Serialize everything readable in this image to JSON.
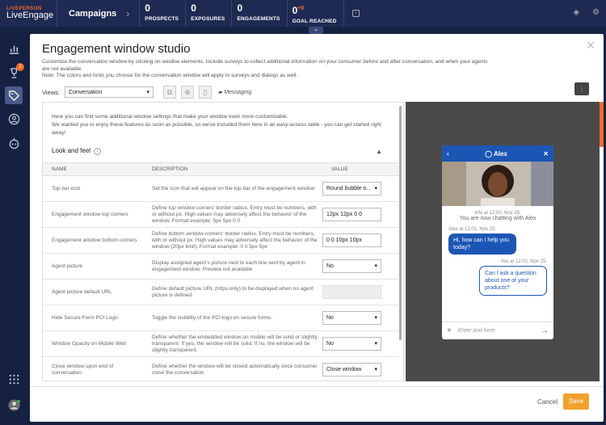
{
  "topbar": {
    "logo_top": "LIVEPERSON",
    "logo_bottom": "LiveEngage",
    "section": "Campaigns",
    "stats": [
      {
        "value": "0",
        "label": "PROSPECTS"
      },
      {
        "value": "0",
        "label": "EXPOSURES"
      },
      {
        "value": "0",
        "label": "ENGAGEMENTS"
      },
      {
        "value": "0",
        "delta": "+0",
        "label": "GOAL REACHED"
      }
    ]
  },
  "nav": {
    "badge": "2"
  },
  "modal": {
    "title": "Engagement window studio",
    "description": "Customize the conversation window by clicking on window elements. Include surveys to collect additional information on your consumer before and after conversation, and when your agents are not available.",
    "note": "Note: The colors and fonts you choose for the conversation window will apply to surveys and dialogs as well.",
    "views_label": "Views:",
    "views_value": "Conversation",
    "messaging_label": "Messaging",
    "intro_1": "Here you can find some additional window settings that make your window even more customizable.",
    "intro_2": "We wanted you to enjoy these features as soon as possible, so we've included them here in an easy-access table - you can get started right away!",
    "section_title": "Look and feel",
    "columns": {
      "name": "NAME",
      "description": "DESCRIPTION",
      "value": "VALUE"
    },
    "rows": [
      {
        "name": "Top bar icon",
        "description": "Set the icon that will appear on the top bar of the engagement window",
        "value": "Round bubble o..."
      },
      {
        "name": "Engagement window top corners",
        "description": "Define top window corners' border radius. Entry must be numbers, with or without px. High values may adversely affect the behavior of the window. Format example: 5px 5px 0 0",
        "value": "12px 12px 0 0"
      },
      {
        "name": "Engagement window bottom corners",
        "description": "Define bottom window corners' border radius. Entry must be numbers, with or without px. High values may adversely affect the behavior of the window (20px limit). Format example: 0 0 5px 5px",
        "value": "0 0 10px 10px"
      },
      {
        "name": "Agent picture",
        "description": "Display assigned agent's picture next to each line sent by agent in engagement window. Preview not available",
        "value": "No"
      },
      {
        "name": "Agent picture default URL",
        "description": "Define default picture URL (https only) to be displayed when no agent picture is defined",
        "value": ""
      },
      {
        "name": "Hide Secure Form PCI Logo",
        "description": "Toggle the visibility of the PCI logo on secure forms.",
        "value": "No"
      },
      {
        "name": "Window Opacity on Mobile Web",
        "description": "Define whether the embedded window on mobile will be solid or slightly transparent. If yes, the window will be solid. If no, the window will be slightly transparent.",
        "value": "No"
      },
      {
        "name": "Close window upon end of conversation",
        "description": "Define whether the window will be closed automatically once consumer close the conversation",
        "value": "Close window"
      }
    ],
    "cancel": "Cancel",
    "save": "Save"
  },
  "preview": {
    "agent_name": "Alex",
    "info_time": "Info at 12:00, Nov 25:",
    "info_text": "You are now chatting with Alex",
    "agent_meta": "Alex at 12:01, Nov 25:",
    "agent_msg": "Hi, how can I help you today?",
    "user_meta": "You at 12:02, Nov 25:",
    "user_msg": "Can I ask a question about one of your products?",
    "input_placeholder": "Enter text here"
  }
}
